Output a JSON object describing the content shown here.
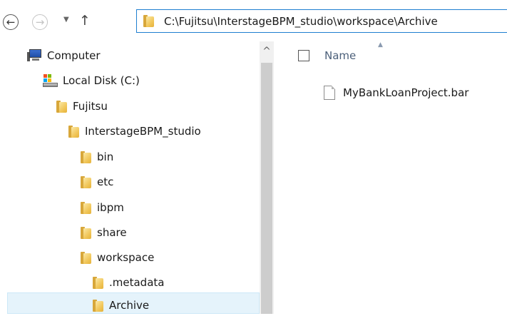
{
  "toolbar": {
    "back_glyph": "←",
    "forward_glyph": "→",
    "recent_glyph": "▼",
    "up_glyph": "↑",
    "address": "C:\\Fujitsu\\InterstageBPM_studio\\workspace\\Archive"
  },
  "navigation_tree": {
    "items": [
      {
        "label": "Computer",
        "icon": "computer-icon",
        "depth": 0
      },
      {
        "label": "Local Disk (C:)",
        "icon": "disk-icon",
        "depth": 1
      },
      {
        "label": "Fujitsu",
        "icon": "folder-icon",
        "depth": 2
      },
      {
        "label": "InterstageBPM_studio",
        "icon": "folder-icon",
        "depth": 3
      },
      {
        "label": "bin",
        "icon": "folder-icon",
        "depth": 4
      },
      {
        "label": "etc",
        "icon": "folder-icon",
        "depth": 4
      },
      {
        "label": "ibpm",
        "icon": "folder-icon",
        "depth": 4
      },
      {
        "label": "share",
        "icon": "folder-icon",
        "depth": 4
      },
      {
        "label": "workspace",
        "icon": "folder-icon",
        "depth": 4
      },
      {
        "label": ".metadata",
        "icon": "folder-icon",
        "depth": 5
      },
      {
        "label": "Archive",
        "icon": "folder-icon",
        "depth": 5,
        "selected": true
      }
    ],
    "scroll_up_glyph": "^"
  },
  "content": {
    "column_header": "Name",
    "sort_glyph": "▲",
    "files": [
      {
        "name": "MyBankLoanProject.bar",
        "icon": "file-icon"
      }
    ]
  },
  "colors": {
    "address_border": "#1f7fd1",
    "selection_bg": "#e5f3fb",
    "header_text": "#4c607a"
  }
}
